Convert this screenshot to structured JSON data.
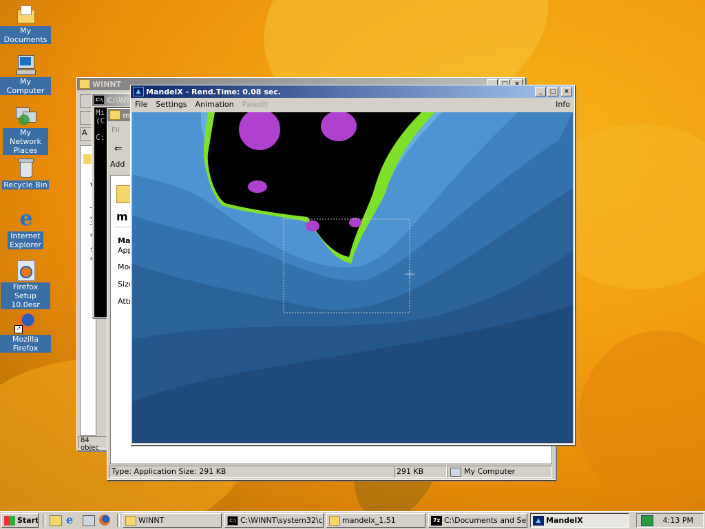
{
  "desktop": {
    "icons": [
      {
        "label": "My Documents",
        "icon": "my-documents-icon"
      },
      {
        "label": "My Computer",
        "icon": "my-computer-icon"
      },
      {
        "label": "My Network Places",
        "icon": "network-places-icon"
      },
      {
        "label": "Recycle Bin",
        "icon": "recycle-bin-icon"
      },
      {
        "label": "Internet Explorer",
        "icon": "internet-explorer-icon"
      },
      {
        "label": "Firefox Setup 10.0esr",
        "icon": "firefox-setup-icon"
      },
      {
        "label": "Mozilla Firefox",
        "icon": "firefox-icon"
      }
    ]
  },
  "winnt_window": {
    "title": "WINNT",
    "status": "84 objec",
    "fragments": {
      "file_menu": "Fil",
      "addr": "A",
      "t": "T",
      "y": "y",
      "t2": "T",
      "c": "c",
      "s": "S",
      "c2": "c",
      "w": "W"
    }
  },
  "cmd_window": {
    "title": "C:\\WI",
    "line1": "Mi",
    "line2": "(C",
    "line3": "C:"
  },
  "mandelx_folder_window": {
    "title": "m",
    "toolbar_fragment": "Fil",
    "address_label": "Add",
    "heading": "m",
    "details": {
      "name": "Ma",
      "type": "App",
      "modified": "Mod",
      "size": "Size",
      "attr": "Attr"
    },
    "status": {
      "main": "Type: Application Size: 291 KB",
      "size": "291 KB",
      "zone": "My Computer"
    }
  },
  "mandelx": {
    "title": "MandelX - Rend.Time:  0.08 sec.",
    "menu": [
      "File",
      "Settings",
      "Animation",
      "Paledit"
    ],
    "info": "Info"
  },
  "taskbar": {
    "start": "Start",
    "quicklaunch": [
      "show-desktop-icon",
      "ie-icon",
      "network-icon",
      "firefox-icon"
    ],
    "tasks": [
      {
        "label": "WINNT",
        "icon": "folder-icon"
      },
      {
        "label": "C:\\WINNT\\system32\\c...",
        "icon": "cmd-icon"
      },
      {
        "label": "mandelx_1.51",
        "icon": "folder-icon"
      },
      {
        "label": "C:\\Documents and Set...",
        "icon": "7zip-icon"
      },
      {
        "label": "MandelX",
        "icon": "mandelx-icon"
      }
    ],
    "clock": "4:13 PM"
  },
  "colors": {
    "accent": "#0a246a",
    "desktop": "#f3a010",
    "fractal_black": "#000000",
    "fractal_green": "#7fe02a",
    "fractal_purple": "#b040d0"
  }
}
